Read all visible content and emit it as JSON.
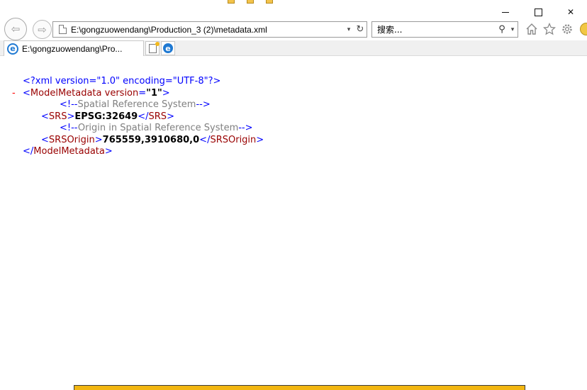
{
  "window": {
    "minimize_label": "",
    "maximize_label": "",
    "close_label": "✕"
  },
  "nav": {
    "back_symbol": "⇦",
    "forward_symbol": "⇨",
    "address": "E:\\gongzuowendang\\Production_3 (2)\\metadata.xml",
    "address_caret": "▾",
    "refresh_symbol": "↻",
    "search_placeholder": "搜索...",
    "search_symbol": "⚲",
    "search_caret": "▾"
  },
  "toolbar_icons": [
    "home-icon",
    "star-icon",
    "gear-icon",
    "smiley-icon"
  ],
  "tab": {
    "title": "E:\\gongzuowendang\\Pro..."
  },
  "xml": {
    "declaration": "<?xml version=\"1.0\" encoding=\"UTF-8\"?>",
    "collapse_marker": "-",
    "root_tag": "ModelMetadata",
    "root_attr_name": "version",
    "root_attr_value": "\"1\"",
    "comment1": "Spatial Reference System",
    "srs_tag": "SRS",
    "srs_value": "EPSG:32649",
    "comment2": "Origin in Spatial Reference System",
    "origin_tag": "SRSOrigin",
    "origin_value": "765559,3910680,0"
  },
  "colors": {
    "tag": "#990000",
    "punctuation": "#0000ff",
    "comment": "#808080",
    "notify_bar": "#f2b611",
    "ie_blue": "#1f79d2"
  }
}
